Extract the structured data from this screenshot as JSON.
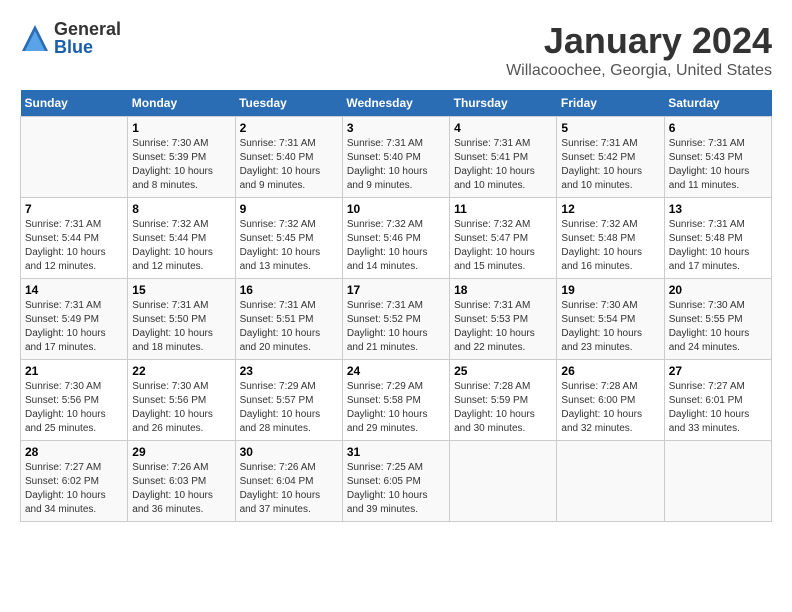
{
  "logo": {
    "general": "General",
    "blue": "Blue"
  },
  "header": {
    "month": "January 2024",
    "location": "Willacoochee, Georgia, United States"
  },
  "weekdays": [
    "Sunday",
    "Monday",
    "Tuesday",
    "Wednesday",
    "Thursday",
    "Friday",
    "Saturday"
  ],
  "weeks": [
    [
      {
        "day": "",
        "info": ""
      },
      {
        "day": "1",
        "info": "Sunrise: 7:30 AM\nSunset: 5:39 PM\nDaylight: 10 hours\nand 8 minutes."
      },
      {
        "day": "2",
        "info": "Sunrise: 7:31 AM\nSunset: 5:40 PM\nDaylight: 10 hours\nand 9 minutes."
      },
      {
        "day": "3",
        "info": "Sunrise: 7:31 AM\nSunset: 5:40 PM\nDaylight: 10 hours\nand 9 minutes."
      },
      {
        "day": "4",
        "info": "Sunrise: 7:31 AM\nSunset: 5:41 PM\nDaylight: 10 hours\nand 10 minutes."
      },
      {
        "day": "5",
        "info": "Sunrise: 7:31 AM\nSunset: 5:42 PM\nDaylight: 10 hours\nand 10 minutes."
      },
      {
        "day": "6",
        "info": "Sunrise: 7:31 AM\nSunset: 5:43 PM\nDaylight: 10 hours\nand 11 minutes."
      }
    ],
    [
      {
        "day": "7",
        "info": "Sunrise: 7:31 AM\nSunset: 5:44 PM\nDaylight: 10 hours\nand 12 minutes."
      },
      {
        "day": "8",
        "info": "Sunrise: 7:32 AM\nSunset: 5:44 PM\nDaylight: 10 hours\nand 12 minutes."
      },
      {
        "day": "9",
        "info": "Sunrise: 7:32 AM\nSunset: 5:45 PM\nDaylight: 10 hours\nand 13 minutes."
      },
      {
        "day": "10",
        "info": "Sunrise: 7:32 AM\nSunset: 5:46 PM\nDaylight: 10 hours\nand 14 minutes."
      },
      {
        "day": "11",
        "info": "Sunrise: 7:32 AM\nSunset: 5:47 PM\nDaylight: 10 hours\nand 15 minutes."
      },
      {
        "day": "12",
        "info": "Sunrise: 7:32 AM\nSunset: 5:48 PM\nDaylight: 10 hours\nand 16 minutes."
      },
      {
        "day": "13",
        "info": "Sunrise: 7:31 AM\nSunset: 5:48 PM\nDaylight: 10 hours\nand 17 minutes."
      }
    ],
    [
      {
        "day": "14",
        "info": "Sunrise: 7:31 AM\nSunset: 5:49 PM\nDaylight: 10 hours\nand 17 minutes."
      },
      {
        "day": "15",
        "info": "Sunrise: 7:31 AM\nSunset: 5:50 PM\nDaylight: 10 hours\nand 18 minutes."
      },
      {
        "day": "16",
        "info": "Sunrise: 7:31 AM\nSunset: 5:51 PM\nDaylight: 10 hours\nand 20 minutes."
      },
      {
        "day": "17",
        "info": "Sunrise: 7:31 AM\nSunset: 5:52 PM\nDaylight: 10 hours\nand 21 minutes."
      },
      {
        "day": "18",
        "info": "Sunrise: 7:31 AM\nSunset: 5:53 PM\nDaylight: 10 hours\nand 22 minutes."
      },
      {
        "day": "19",
        "info": "Sunrise: 7:30 AM\nSunset: 5:54 PM\nDaylight: 10 hours\nand 23 minutes."
      },
      {
        "day": "20",
        "info": "Sunrise: 7:30 AM\nSunset: 5:55 PM\nDaylight: 10 hours\nand 24 minutes."
      }
    ],
    [
      {
        "day": "21",
        "info": "Sunrise: 7:30 AM\nSunset: 5:56 PM\nDaylight: 10 hours\nand 25 minutes."
      },
      {
        "day": "22",
        "info": "Sunrise: 7:30 AM\nSunset: 5:56 PM\nDaylight: 10 hours\nand 26 minutes."
      },
      {
        "day": "23",
        "info": "Sunrise: 7:29 AM\nSunset: 5:57 PM\nDaylight: 10 hours\nand 28 minutes."
      },
      {
        "day": "24",
        "info": "Sunrise: 7:29 AM\nSunset: 5:58 PM\nDaylight: 10 hours\nand 29 minutes."
      },
      {
        "day": "25",
        "info": "Sunrise: 7:28 AM\nSunset: 5:59 PM\nDaylight: 10 hours\nand 30 minutes."
      },
      {
        "day": "26",
        "info": "Sunrise: 7:28 AM\nSunset: 6:00 PM\nDaylight: 10 hours\nand 32 minutes."
      },
      {
        "day": "27",
        "info": "Sunrise: 7:27 AM\nSunset: 6:01 PM\nDaylight: 10 hours\nand 33 minutes."
      }
    ],
    [
      {
        "day": "28",
        "info": "Sunrise: 7:27 AM\nSunset: 6:02 PM\nDaylight: 10 hours\nand 34 minutes."
      },
      {
        "day": "29",
        "info": "Sunrise: 7:26 AM\nSunset: 6:03 PM\nDaylight: 10 hours\nand 36 minutes."
      },
      {
        "day": "30",
        "info": "Sunrise: 7:26 AM\nSunset: 6:04 PM\nDaylight: 10 hours\nand 37 minutes."
      },
      {
        "day": "31",
        "info": "Sunrise: 7:25 AM\nSunset: 6:05 PM\nDaylight: 10 hours\nand 39 minutes."
      },
      {
        "day": "",
        "info": ""
      },
      {
        "day": "",
        "info": ""
      },
      {
        "day": "",
        "info": ""
      }
    ]
  ]
}
